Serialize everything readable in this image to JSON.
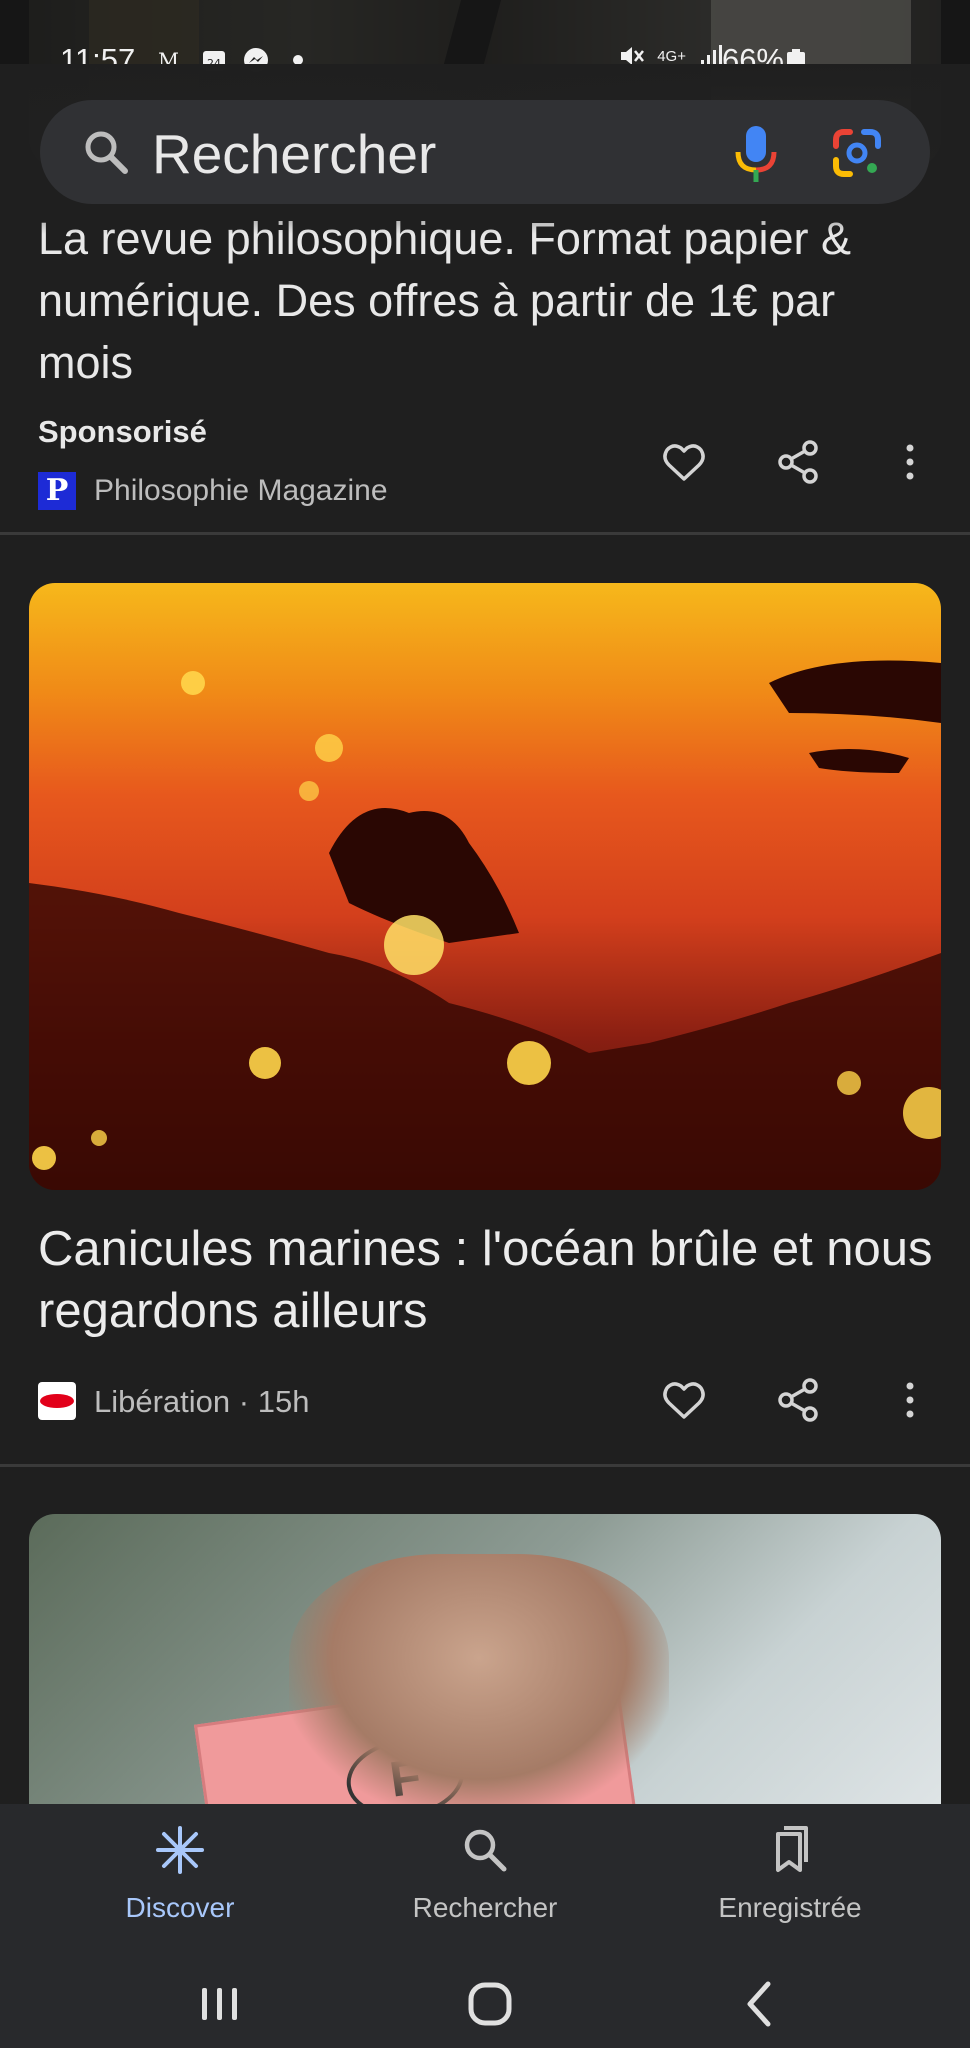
{
  "status_bar": {
    "time": "11:57",
    "network": "4G+",
    "battery": "66%"
  },
  "search": {
    "placeholder": "Rechercher"
  },
  "ad_card": {
    "headline": "La revue philosophique. Format papier & numérique. Des offres à partir de 1€ par mois",
    "sponsored": "Sponsorisé",
    "source_logo_letter": "P",
    "source": "Philosophie Magazine"
  },
  "article_card": {
    "headline": "Canicules marines : l'océan brûle et nous regardons ailleurs",
    "source": "Libération",
    "separator": "·",
    "age": "15h"
  },
  "next_card": {
    "badge_letter": "F"
  },
  "bottom_nav": {
    "items": [
      {
        "label": "Discover",
        "icon": "discover-icon",
        "active": true
      },
      {
        "label": "Rechercher",
        "icon": "search-icon",
        "active": false
      },
      {
        "label": "Enregistrée",
        "icon": "saved-icon",
        "active": false
      }
    ]
  },
  "colors": {
    "background": "#1f1f1f",
    "active_nav": "#a8c7fa",
    "search_bar": "#303134"
  }
}
